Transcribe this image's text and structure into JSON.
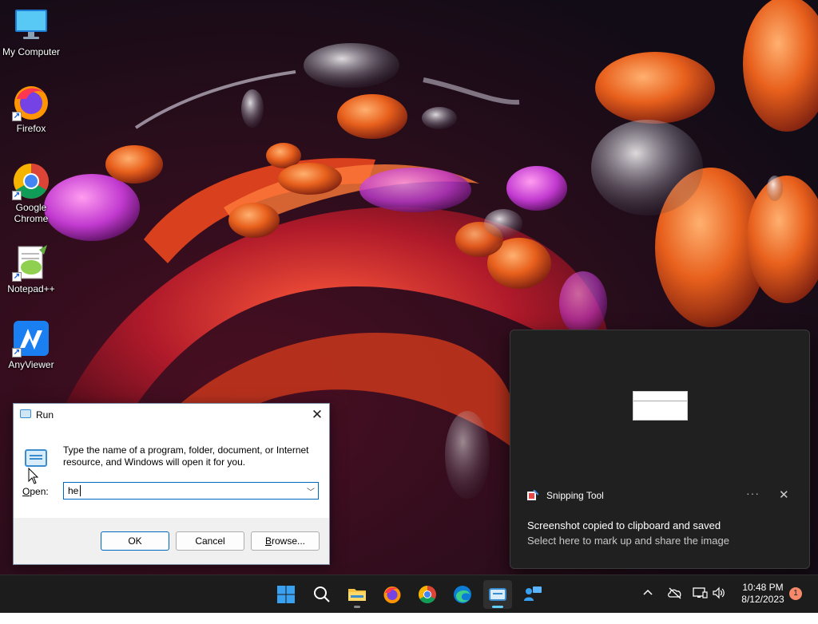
{
  "desktop": {
    "icons": [
      {
        "label": "My Computer"
      },
      {
        "label": "Firefox"
      },
      {
        "label": "Google Chrome"
      },
      {
        "label": "Notepad++"
      },
      {
        "label": "AnyViewer"
      }
    ]
  },
  "run_dialog": {
    "title": "Run",
    "description": "Type the name of a program, folder, document, or Internet resource, and Windows will open it for you.",
    "open_label_first": "O",
    "open_label_rest": "pen:",
    "input_value": "he",
    "ok_label": "OK",
    "cancel_label": "Cancel",
    "browse_label_first": "B",
    "browse_label_rest": "rowse..."
  },
  "toast": {
    "app_name": "Snipping Tool",
    "more_label": "···",
    "title": "Screenshot copied to clipboard and saved",
    "subtitle": "Select here to mark up and share the image"
  },
  "taskbar": {
    "items": [
      "start",
      "search",
      "file-explorer",
      "firefox",
      "chrome",
      "edge",
      "run",
      "anyviewer"
    ],
    "active_item": "run",
    "clock_time": "10:48 PM",
    "clock_date": "8/12/2023",
    "notification_count": "1"
  },
  "colors": {
    "accent": "#0067c0",
    "taskbar_bg": "#1c1c1c",
    "toast_bg": "#202020",
    "active_indicator": "#60cdff"
  }
}
